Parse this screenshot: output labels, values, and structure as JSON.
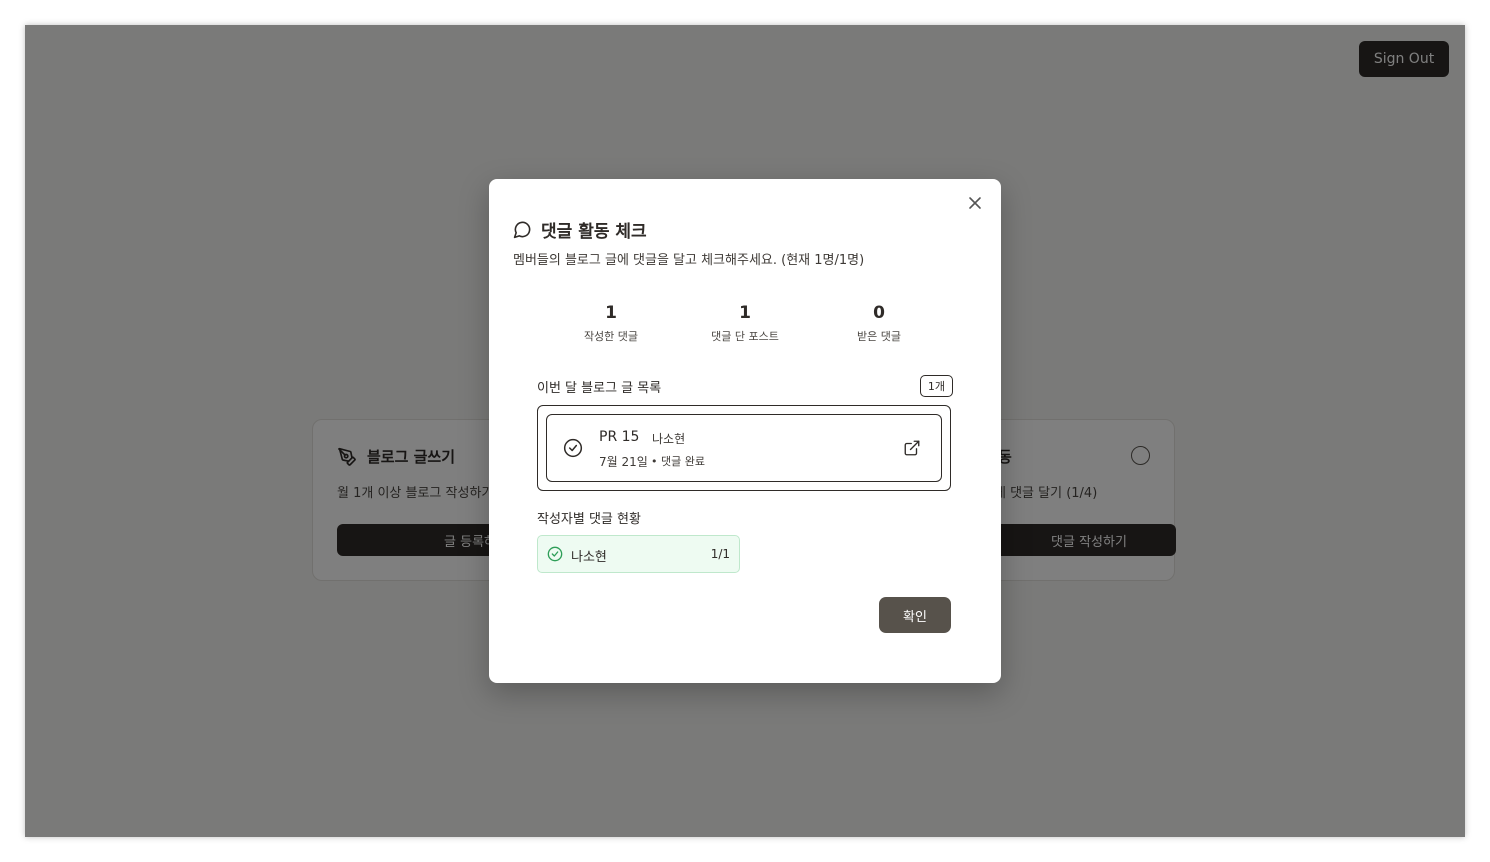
{
  "header": {
    "signout_label": "Sign Out"
  },
  "background": {
    "left_card": {
      "title": "블로그 글쓰기",
      "desc": "월 1개 이상 블로그 작성하기",
      "button": "글 등록하기"
    },
    "right_card": {
      "title": "동",
      "desc": "게 댓글 달기 (1/4)",
      "button": "댓글 작성하기"
    }
  },
  "modal": {
    "title": "댓글 활동 체크",
    "subtitle": "멤버들의 블로그 글에 댓글을 달고 체크해주세요. (현재 1명/1명)",
    "stats": [
      {
        "value": "1",
        "label": "작성한 댓글"
      },
      {
        "value": "1",
        "label": "댓글 단 포스트"
      },
      {
        "value": "0",
        "label": "받은 댓글"
      }
    ],
    "posts_heading": "이번 달 블로그 글 목록",
    "posts_count": "1개",
    "posts": [
      {
        "title": "PR 15",
        "author": "나소현",
        "date": "7월 21일",
        "status": "• 댓글 완료"
      }
    ],
    "authors_heading": "작성자별 댓글 현황",
    "authors": [
      {
        "name": "나소현",
        "count": "1/1"
      }
    ],
    "confirm_label": "확인"
  },
  "colors": {
    "primary": "#2f2b28",
    "confirm": "#57524b",
    "success": "#2e9e58",
    "success_bg": "#eefbf2"
  }
}
